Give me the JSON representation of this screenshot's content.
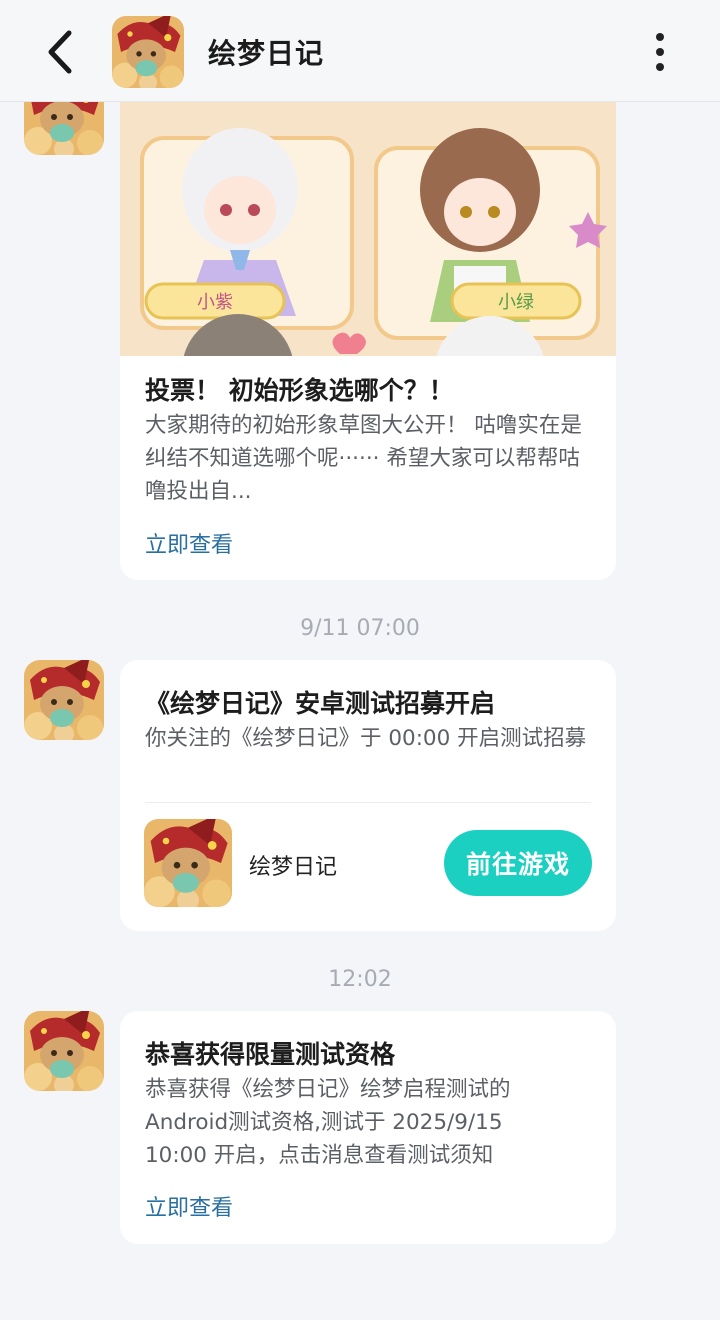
{
  "header": {
    "title": "绘梦日记",
    "back_icon": "chevron-left-icon",
    "more_icon": "more-vertical-icon"
  },
  "messages": [
    {
      "banner": {
        "char_left_label": "小紫",
        "char_right_label": "小绿"
      },
      "title": "投票！ 初始形象选哪个？！",
      "body": "大家期待的初始形象草图大公开！ 咕噜实在是纠结不知道选哪个呢······ 希望大家可以帮帮咕噜投出自...",
      "link": "立即查看"
    },
    {
      "timestamp": "9/11  07:00",
      "title": "《绘梦日记》安卓测试招募开启",
      "body": "你关注的《绘梦日记》于 00:00 开启测试招募",
      "game_name": "绘梦日记",
      "button": "前往游戏"
    },
    {
      "timestamp": "12:02",
      "title": "恭喜获得限量测试资格",
      "body_line1": "恭喜获得《绘梦日记》绘梦启程测试的",
      "body_line2": "Android测试资格,测试于 2025/9/15",
      "body_line3": "10:00 开启，点击消息查看测试须知",
      "link": "立即查看"
    }
  ],
  "colors": {
    "accent": "#1bd0c0",
    "link": "#2a6fa1",
    "background": "#f4f5f8"
  }
}
